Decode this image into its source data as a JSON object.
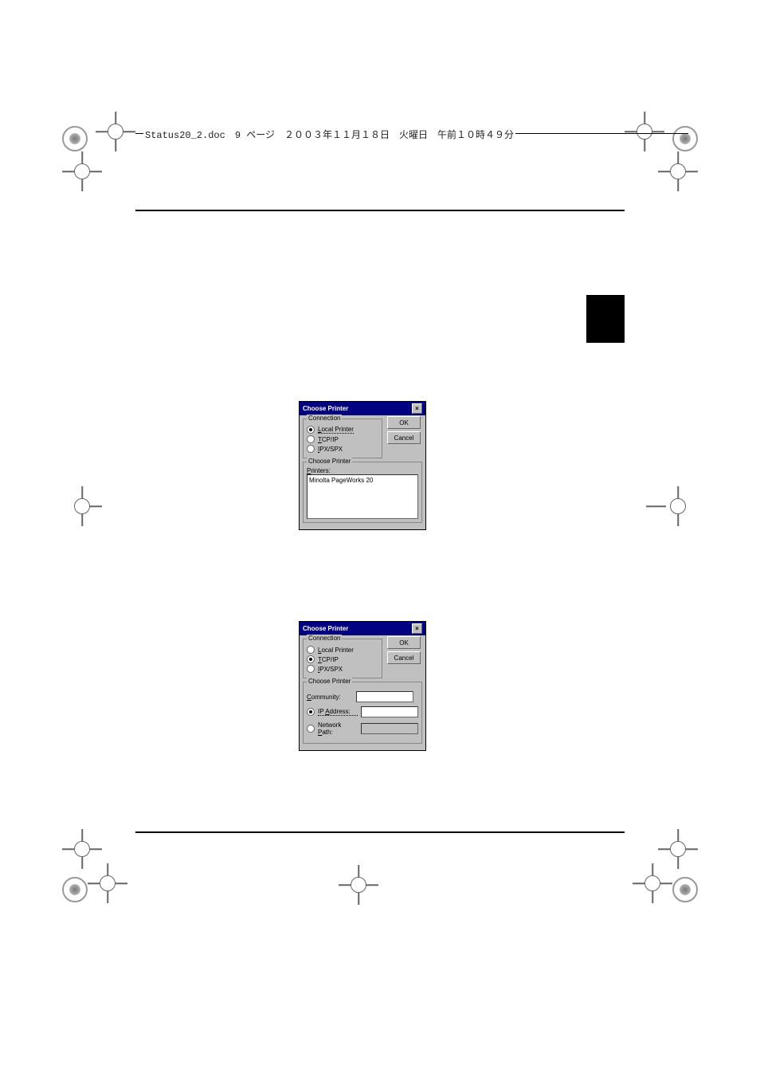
{
  "header_text": "Status20_2.doc　9 ページ　２００３年１１月１８日　火曜日　午前１０時４９分",
  "dialog1": {
    "title": "Choose Printer",
    "ok": "OK",
    "cancel": "Cancel",
    "group_connection": "Connection",
    "radio_local": "Local Printer",
    "radio_tcpip": "TCP/IP",
    "radio_ipxspx": "IPX/SPX",
    "group_choose": "Choose Printer",
    "printers_label": "Printers:",
    "list_item": "Minolta PageWorks 20"
  },
  "dialog2": {
    "title": "Choose Printer",
    "ok": "OK",
    "cancel": "Cancel",
    "group_connection": "Connection",
    "radio_local": "Local Printer",
    "radio_tcpip": "TCP/IP",
    "radio_ipxspx": "IPX/SPX",
    "group_choose": "Choose Printer",
    "community_label": "Community:",
    "ipaddress_label": "IP Address:",
    "netpath_label": "Network Path:"
  }
}
